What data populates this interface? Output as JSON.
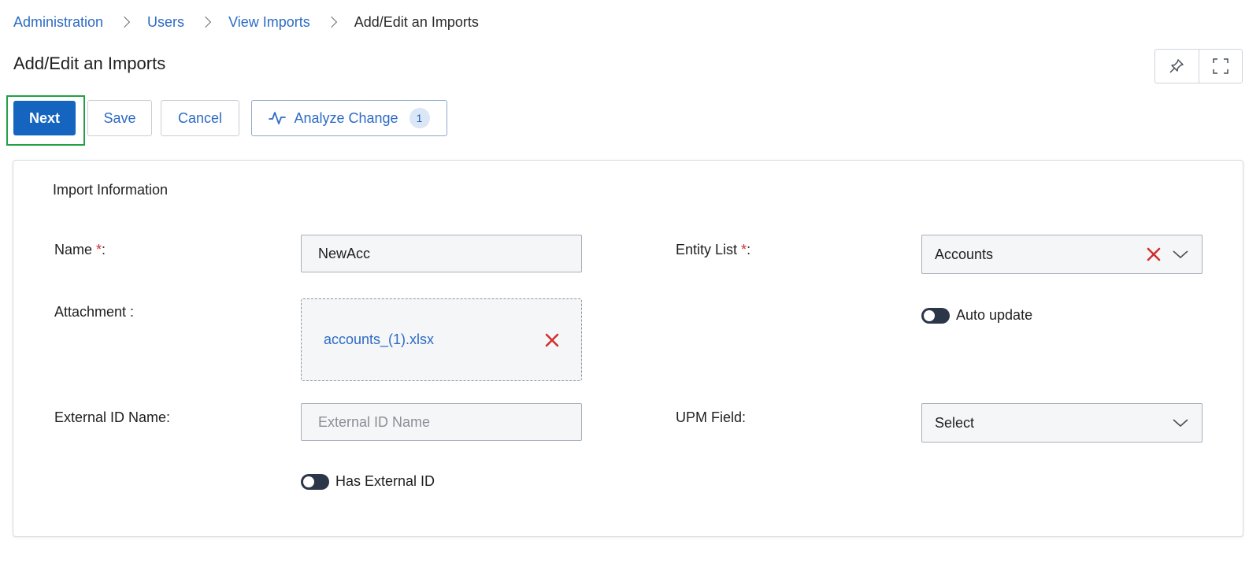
{
  "breadcrumb": {
    "items": [
      "Administration",
      "Users",
      "View Imports"
    ],
    "current": "Add/Edit an Imports"
  },
  "page": {
    "title": "Add/Edit an Imports"
  },
  "top_icons": {
    "pin": "pin-icon",
    "fullscreen": "fullscreen-icon"
  },
  "actions": {
    "next": "Next",
    "save": "Save",
    "cancel": "Cancel",
    "analyze": "Analyze Change",
    "analyze_count": "1"
  },
  "form": {
    "section_title": "Import Information",
    "name": {
      "label": "Name",
      "required": "*",
      "suffix": ":",
      "value": "NewAcc"
    },
    "attachment": {
      "label": "Attachment :",
      "file": "accounts_(1).xlsx"
    },
    "external_id": {
      "label": "External ID Name:",
      "placeholder": "External ID Name",
      "value": ""
    },
    "has_external_id": {
      "label": "Has External ID",
      "on": false
    },
    "entity_list": {
      "label": "Entity List",
      "required": "*",
      "suffix": ":",
      "value": "Accounts"
    },
    "auto_update": {
      "label": "Auto update",
      "on": false
    },
    "upm_field": {
      "label": "UPM Field:",
      "value": "Select"
    }
  },
  "colors": {
    "primary": "#1565c0",
    "link": "#2d6bc4",
    "danger": "#d03030",
    "focus": "#22a045",
    "toggle_off": "#2b3648"
  }
}
